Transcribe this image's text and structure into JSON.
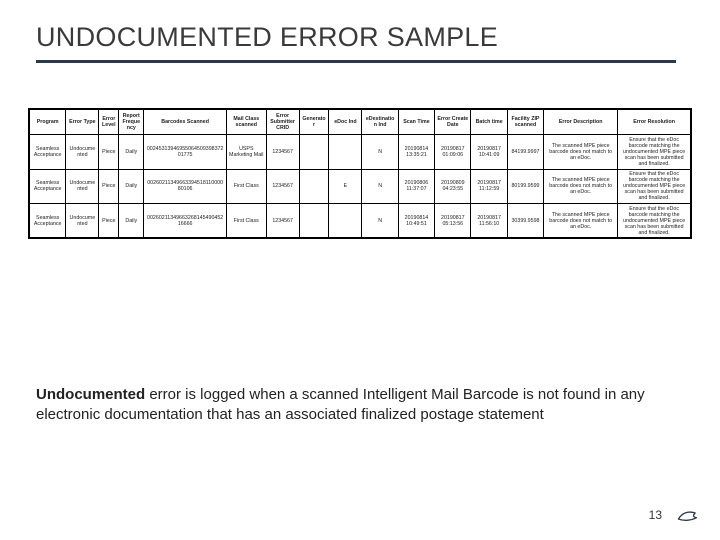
{
  "title": "UNDOCUMENTED ERROR SAMPLE",
  "table": {
    "headers": [
      "Program",
      "Error Type",
      "Error Level",
      "Report Frequency",
      "Barcodes Scanned",
      "Mail Class scanned",
      "Error Submitter CRID",
      "Generator",
      "eDoc Ind",
      "eDestination Ind",
      "Scan Time",
      "Error Create Date",
      "Batch time",
      "Facility ZIP scanned",
      "Error Description",
      "Error Resolution"
    ],
    "rows": [
      {
        "program": "Seamless Acceptance",
        "etype": "Undocumented",
        "level": "Piece",
        "freq": "Daily",
        "barcode": "0024531394695506450939837201775",
        "mclass": "USPS Marketing Mail",
        "crid": "1234567",
        "gen": "",
        "edoc": "",
        "edest": "N",
        "stime": "20190814 13:35:21",
        "edate": "20190817 01:09:06",
        "btime": "20190817 10:41:09",
        "zip": "84199.9997",
        "desc": "The scanned MPE piece barcode does not match to an eDoc.",
        "res": "Ensure that the eDoc barcode matching the undocumented MPE piece scan has been submitted and finalized."
      },
      {
        "program": "Seamless Acceptance",
        "etype": "Undocumented",
        "level": "Piece",
        "freq": "Daily",
        "barcode": "0026021134966339451811000080106",
        "mclass": "First Class",
        "crid": "1234567",
        "gen": "",
        "edoc": "E",
        "edest": "N",
        "stime": "20190806 11:37:07",
        "edate": "20190809 04:23:55",
        "btime": "20190817 11:12:59",
        "zip": "80199.9599",
        "desc": "The scanned MPE piece barcode does not match to an eDoc.",
        "res": "Ensure that the eDoc barcode matching the undocumented MPE piece scan has been submitted and finalized."
      },
      {
        "program": "Seamless Acceptance",
        "etype": "Undocumented",
        "level": "Piece",
        "freq": "Daily",
        "barcode": "0026021134966326814549045216666",
        "mclass": "First Class",
        "crid": "1234567",
        "gen": "",
        "edoc": "",
        "edest": "N",
        "stime": "20190814 10:49:51",
        "edate": "20190817 05:13:56",
        "btime": "20190817 11:56:10",
        "zip": "30399.9598",
        "desc": "The scanned MPE piece barcode does not match to an eDoc.",
        "res": "Ensure that the eDoc barcode matching the undocumented MPE piece scan has been submitted and finalized."
      }
    ]
  },
  "caption": {
    "bold": "Undocumented",
    "rest": " error is logged when a scanned Intelligent Mail Barcode is not found in any electronic documentation that has an associated finalized postage statement"
  },
  "page_number": "13",
  "footer_icon_name": "eagle-logo"
}
